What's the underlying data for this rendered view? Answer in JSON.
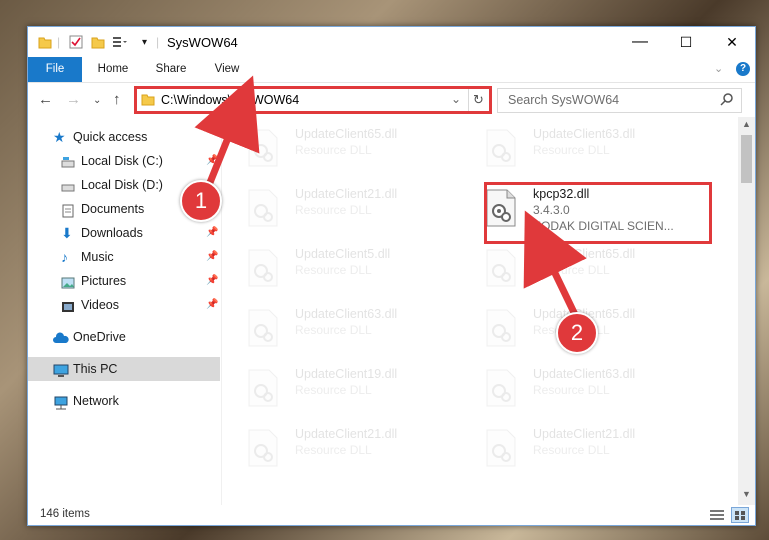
{
  "window": {
    "title": "SysWOW64",
    "controls": {
      "minimize": "—",
      "maximize": "☐",
      "close": "✕"
    }
  },
  "ribbon": {
    "tabs": [
      "File",
      "Home",
      "Share",
      "View"
    ]
  },
  "navigation": {
    "address": "C:\\Windows\\SysWOW64",
    "search_placeholder": "Search SysWOW64"
  },
  "sidebar": {
    "quick_access": "Quick access",
    "items": [
      {
        "label": "Local Disk (C:)",
        "icon": "drive-icon",
        "pinned": true
      },
      {
        "label": "Local Disk (D:)",
        "icon": "drive-icon",
        "pinned": false
      },
      {
        "label": "Documents",
        "icon": "documents-icon",
        "pinned": true
      },
      {
        "label": "Downloads",
        "icon": "downloads-icon",
        "pinned": true
      },
      {
        "label": "Music",
        "icon": "music-icon",
        "pinned": true
      },
      {
        "label": "Pictures",
        "icon": "pictures-icon",
        "pinned": true
      },
      {
        "label": "Videos",
        "icon": "videos-icon",
        "pinned": true
      }
    ],
    "onedrive": "OneDrive",
    "this_pc": "This PC",
    "network": "Network"
  },
  "files": {
    "left": [
      {
        "name": "UpdateClient65.dll",
        "type": "Resource DLL"
      },
      {
        "name": "UpdateClient21.dll",
        "type": "Resource DLL"
      },
      {
        "name": "UpdateClient5.dll",
        "type": "Resource DLL"
      },
      {
        "name": "UpdateClient63.dll",
        "type": "Resource DLL"
      },
      {
        "name": "UpdateClient19.dll",
        "type": "Resource DLL"
      },
      {
        "name": "UpdateClient21.dll",
        "type": "Resource DLL"
      }
    ],
    "right": [
      {
        "name": "UpdateClient63.dll",
        "type": "Resource DLL"
      },
      {
        "name": "kpcp32.dll",
        "version": "3.4.3.0",
        "company": "KODAK DIGITAL SCIEN...",
        "highlighted": true
      },
      {
        "name": "UpdateClient65.dll",
        "type": "Resource DLL"
      },
      {
        "name": "UpdateClient65.dll",
        "type": "Resource DLL"
      },
      {
        "name": "UpdateClient63.dll",
        "type": "Resource DLL"
      },
      {
        "name": "UpdateClient21.dll",
        "type": "Resource DLL"
      }
    ]
  },
  "status": {
    "item_count": "146 items"
  },
  "annotations": {
    "step1": "1",
    "step2": "2",
    "color": "#e0393b"
  }
}
